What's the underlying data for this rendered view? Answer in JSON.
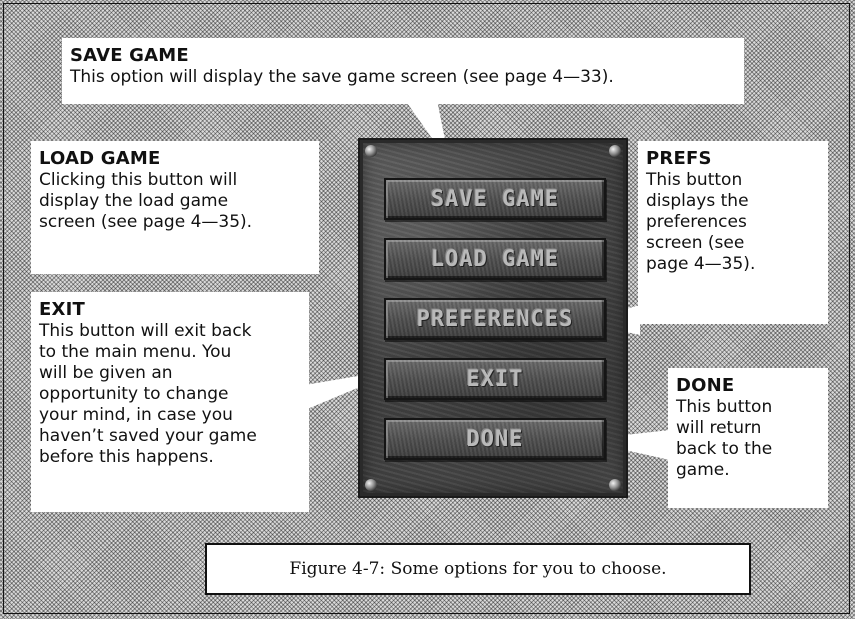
{
  "callouts": {
    "save_game": {
      "title": "SAVE GAME",
      "body": "This option will display the save game screen (see page 4—33)."
    },
    "load_game": {
      "title": "LOAD GAME",
      "lines": [
        "Clicking this button will",
        "display the load game",
        "screen (see page 4—35)."
      ]
    },
    "prefs": {
      "title": "PREFS",
      "lines": [
        "This button",
        "displays the",
        "preferences",
        "screen (see",
        "page 4—35)."
      ]
    },
    "exit": {
      "title": "EXIT",
      "lines": [
        "This button will exit back",
        "to the main menu.  You",
        "will be given an",
        "opportunity to change",
        "your mind, in case you",
        "haven’t saved your game",
        "before this happens."
      ]
    },
    "done": {
      "title": "DONE",
      "lines": [
        "This button",
        "will return",
        "back to the",
        "game."
      ]
    }
  },
  "menu": {
    "buttons": [
      "SAVE GAME",
      "LOAD GAME",
      "PREFERENCES",
      "EXIT",
      "DONE"
    ]
  },
  "caption": "Figure 4-7: Some options for you to choose."
}
